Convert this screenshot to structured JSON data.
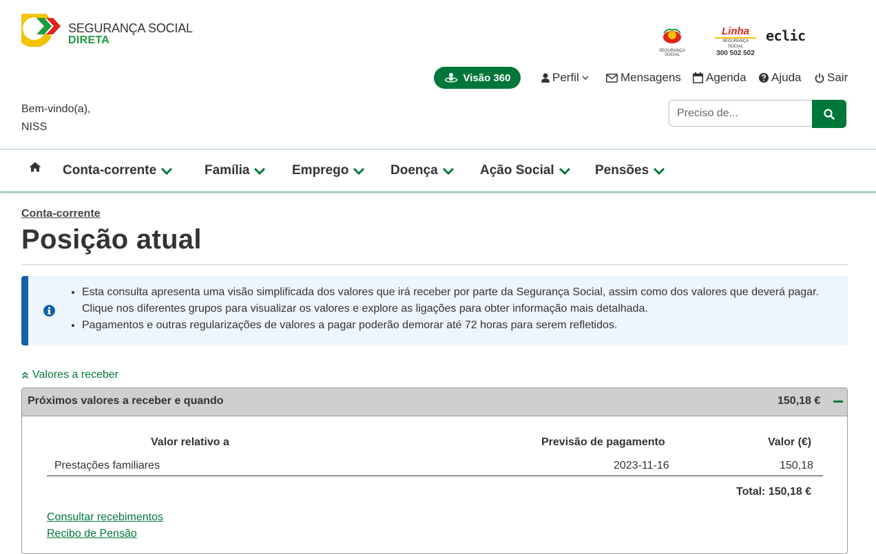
{
  "header": {
    "logo_line1": "SEGURANÇA SOCIAL",
    "logo_line2": "DIRETA",
    "partner1_caption": "SEGURANÇA SOCIAL",
    "partner2_name": "Linha",
    "partner2_caption": "SEGURANÇA SOCIAL",
    "partner2_phone": "300 502 502",
    "partner3_name": "eclic",
    "visao_label": "Visão 360",
    "perfil_label": "Perfil",
    "mensagens_label": "Mensagens",
    "agenda_label": "Agenda",
    "ajuda_label": "Ajuda",
    "sair_label": "Sair"
  },
  "welcome": {
    "greeting": "Bem-vindo(a),",
    "user": "NISS"
  },
  "search": {
    "placeholder": "Preciso de...",
    "value": ""
  },
  "nav": {
    "items": [
      "Conta-corrente",
      "Família",
      "Emprego",
      "Doença",
      "Ação Social",
      "Pensões"
    ]
  },
  "main": {
    "breadcrumb": "Conta-corrente",
    "title": "Posição atual",
    "info": [
      "Esta consulta apresenta uma visão simplificada dos valores que irá receber por parte da Segurança Social, assim como dos valores que deverá pagar. Clique nos diferentes grupos para visualizar os valores e explore as ligações para obter informação mais detalhada.",
      "Pagamentos e outras regularizações de valores a pagar poderão demorar até 72 horas para serem refletidos."
    ],
    "toggle_label": "Valores a receber",
    "panel": {
      "title": "Próximos valores a receber e quando",
      "total": "150,18 €",
      "columns": [
        "Valor relativo a",
        "Previsão de pagamento",
        "Valor (€)"
      ],
      "rows": [
        {
          "relativo": "Prestações familiares",
          "previsao": "2023-11-16",
          "valor": "150,18"
        }
      ],
      "total_line": "Total: 150,18 €",
      "links": [
        "Consultar recebimentos",
        "Recibo de Pensão"
      ]
    }
  },
  "colors": {
    "brand_green": "#00773a",
    "info_blue": "#1460aa",
    "logo_yellow": "#f5c200",
    "logo_red": "#e2231a"
  }
}
